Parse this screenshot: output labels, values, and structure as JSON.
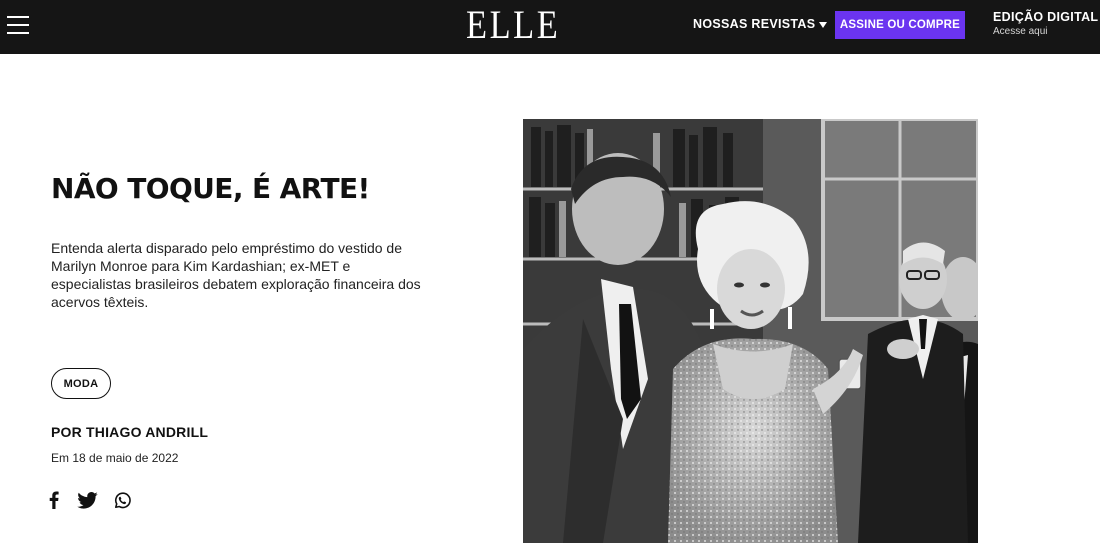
{
  "header": {
    "logo": "ELLE",
    "magazines_label": "NOSSAS REVISTAS",
    "subscribe_label": "ASSINE OU COMPRE",
    "edition_title": "EDIÇÃO DIGITAL",
    "edition_subtitle": "Acesse aqui",
    "menu_icon": "hamburger-menu-icon",
    "accent_color": "#6b34f0"
  },
  "article": {
    "headline": "NÃO TOQUE, É ARTE!",
    "dek": "Entenda alerta disparado pelo empréstimo do vestido de Marilyn Monroe para Kim Kardashian; ex-MET e especialistas brasileiros debatem exploração financeira dos acervos têxteis.",
    "tag": "MODA",
    "author": "POR THIAGO ANDRILL",
    "date": "Em 18 de maio de 2022",
    "share_icons": [
      "facebook-icon",
      "twitter-icon",
      "whatsapp-icon"
    ]
  }
}
